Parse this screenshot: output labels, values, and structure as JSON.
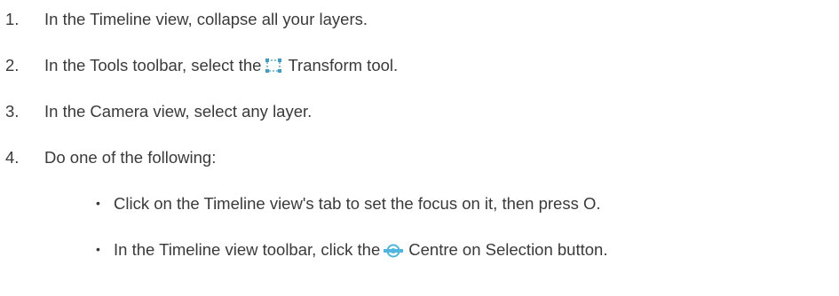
{
  "steps": [
    {
      "number": "1.",
      "text": "In the Timeline view, collapse all your layers."
    },
    {
      "number": "2.",
      "text_before": "In the Tools toolbar, select the",
      "icon": "transform-tool-icon",
      "text_after": "Transform tool."
    },
    {
      "number": "3.",
      "text": "In the Camera view, select any layer."
    },
    {
      "number": "4.",
      "text": "Do one of the following:",
      "bullets": [
        {
          "bullet": "•",
          "text": "Click on the Timeline view's tab to set the focus on it, then press O."
        },
        {
          "bullet": "•",
          "text_before": "In the Timeline view toolbar, click the",
          "icon": "centre-on-selection-icon",
          "text_after": "Centre on Selection button."
        }
      ]
    }
  ],
  "colors": {
    "text": "#3a3a3a",
    "transform_icon": "#3aa0c8",
    "centre_icon": "#4fb6e0"
  }
}
